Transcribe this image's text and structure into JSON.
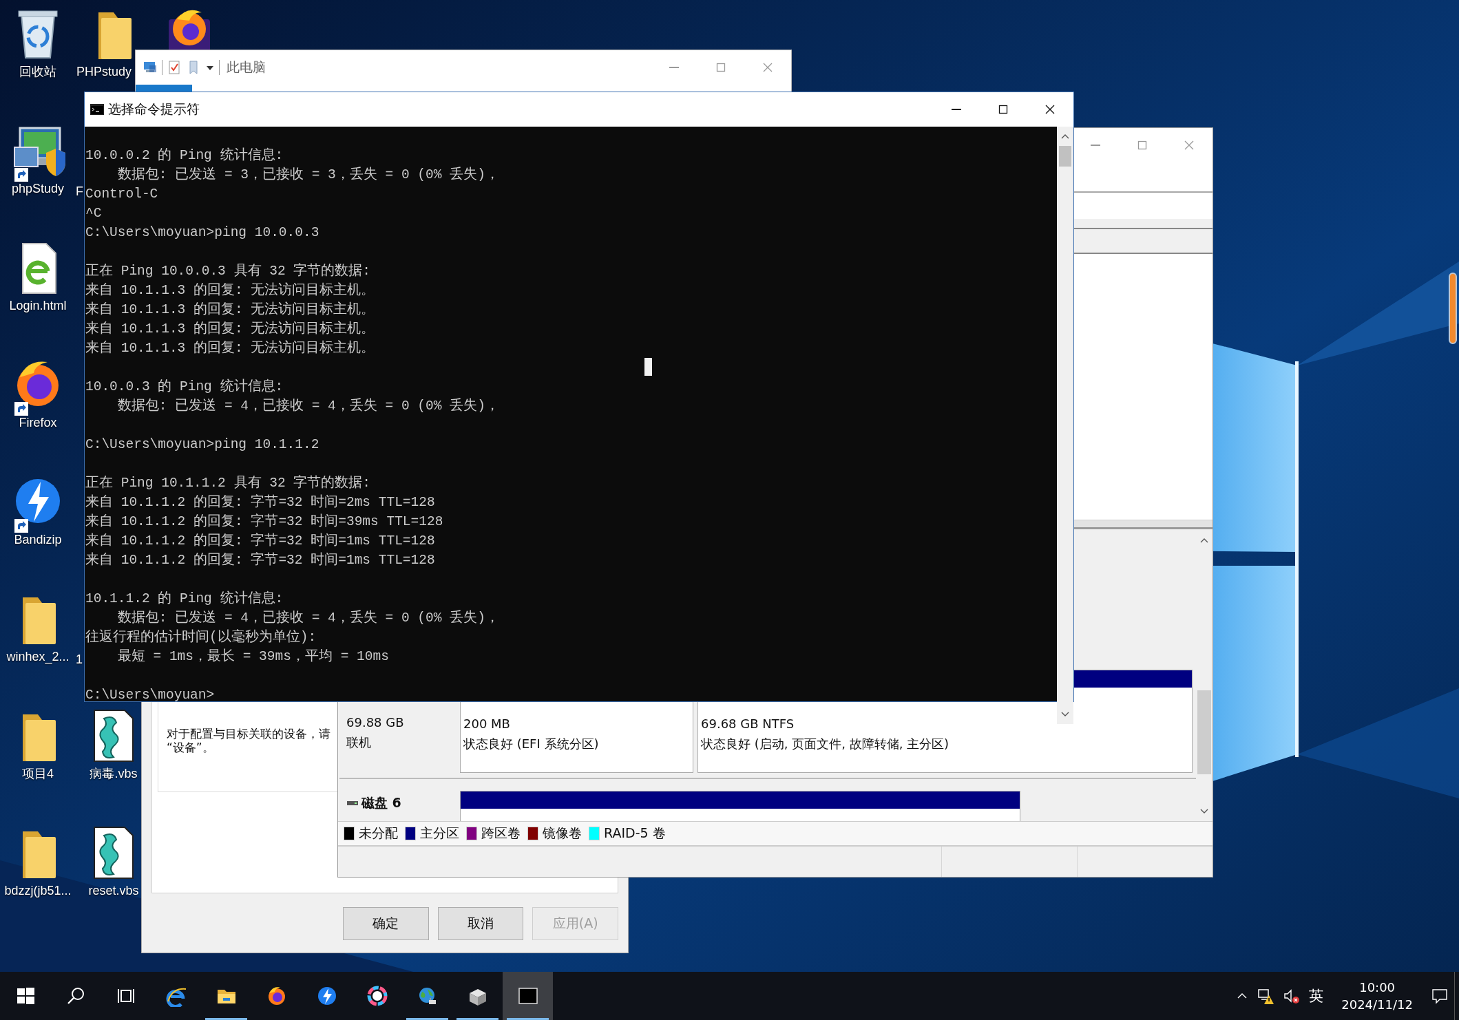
{
  "desktop": {
    "icons": [
      {
        "label": "回收站",
        "kind": "recycle-bin",
        "shortcut": false
      },
      {
        "label": "phpStudy",
        "kind": "phpstudy",
        "shortcut": true
      },
      {
        "label": "Login.html",
        "kind": "html-file",
        "shortcut": false
      },
      {
        "label": "Firefox",
        "kind": "firefox",
        "shortcut": true
      },
      {
        "label": "Bandizip",
        "kind": "bandizip",
        "shortcut": true
      },
      {
        "label": "winhex_2...",
        "kind": "folder",
        "shortcut": false
      },
      {
        "label": "项目4",
        "kind": "folder",
        "shortcut": false
      },
      {
        "label": "bdzzj(jb51...",
        "kind": "folder",
        "shortcut": false
      },
      {
        "label": "PHPstudy",
        "kind": "folder",
        "shortcut": false
      },
      {
        "label": "病毒.vbs",
        "kind": "script-file",
        "shortcut": false
      },
      {
        "label": "reset.vbs",
        "kind": "script-file",
        "shortcut": false
      },
      {
        "kind": "firefox-dev",
        "shortcut": false
      }
    ],
    "partial_labels": [
      "F",
      "1"
    ]
  },
  "explorer_window": {
    "title": "此电脑"
  },
  "disk_management": {
    "disks": [
      {
        "capacity": "69.88 GB",
        "status": "联机",
        "partitions": [
          {
            "size": "200 MB",
            "status": "状态良好 (EFI 系统分区)"
          },
          {
            "size": "69.68 GB NTFS",
            "status": "状态良好 (启动, 页面文件, 故障转储, 主分区)"
          }
        ]
      },
      {
        "name": "磁盘 6"
      }
    ],
    "legend": [
      {
        "label": "未分配",
        "color": "#000000"
      },
      {
        "label": "主分区",
        "color": "#000080"
      },
      {
        "label": "跨区卷",
        "color": "#800080"
      },
      {
        "label": "镜像卷",
        "color": "#800000"
      },
      {
        "label": "RAID-5 卷",
        "color": "#00ffff"
      }
    ]
  },
  "properties_dialog": {
    "text_lines": [
      "对于配置与目标关联的设备，请",
      "“设备”。"
    ],
    "buttons": [
      {
        "label": "确定",
        "disabled": false
      },
      {
        "label": "取消",
        "disabled": false
      },
      {
        "label": "应用(A)",
        "disabled": true
      }
    ]
  },
  "cmd_window": {
    "title": "选择命令提示符",
    "blocks": [
      [
        "10.0.0.2 的 Ping 统计信息:",
        "    数据包: 已发送 = 3，已接收 = 3，丢失 = 0 (0% 丢失)，",
        "Control-C",
        "^C",
        "C:\\Users\\moyuan>ping 10.0.0.3"
      ],
      [
        "正在 Ping 10.0.0.3 具有 32 字节的数据:",
        "来自 10.1.1.3 的回复: 无法访问目标主机。",
        "来自 10.1.1.3 的回复: 无法访问目标主机。",
        "来自 10.1.1.3 的回复: 无法访问目标主机。",
        "来自 10.1.1.3 的回复: 无法访问目标主机。"
      ],
      [
        "10.0.0.3 的 Ping 统计信息:",
        "    数据包: 已发送 = 4，已接收 = 4，丢失 = 0 (0% 丢失)，"
      ],
      [
        "C:\\Users\\moyuan>ping 10.1.1.2"
      ],
      [
        "正在 Ping 10.1.1.2 具有 32 字节的数据:",
        "来自 10.1.1.2 的回复: 字节=32 时间=2ms TTL=128",
        "来自 10.1.1.2 的回复: 字节=32 时间=39ms TTL=128",
        "来自 10.1.1.2 的回复: 字节=32 时间=1ms TTL=128",
        "来自 10.1.1.2 的回复: 字节=32 时间=1ms TTL=128"
      ],
      [
        "10.1.1.2 的 Ping 统计信息:",
        "    数据包: 已发送 = 4，已接收 = 4，丢失 = 0 (0% 丢失)，",
        "往返行程的估计时间(以毫秒为单位):",
        "    最短 = 1ms，最长 = 39ms，平均 = 10ms"
      ],
      [
        "C:\\Users\\moyuan>"
      ]
    ]
  },
  "taskbar": {
    "apps": [
      {
        "kind": "start",
        "running": false,
        "selected": false
      },
      {
        "kind": "search",
        "running": false,
        "selected": false
      },
      {
        "kind": "task-view",
        "running": false,
        "selected": false
      },
      {
        "kind": "ie",
        "running": false,
        "selected": false
      },
      {
        "kind": "explorer",
        "running": true,
        "selected": false
      },
      {
        "kind": "firefox",
        "running": false,
        "selected": false
      },
      {
        "kind": "bandizip",
        "running": false,
        "selected": false
      },
      {
        "kind": "ai-app",
        "running": false,
        "selected": false
      },
      {
        "kind": "globe",
        "running": true,
        "selected": false
      },
      {
        "kind": "package",
        "running": true,
        "selected": false
      },
      {
        "kind": "terminal",
        "running": true,
        "selected": true
      }
    ],
    "tray": {
      "input_method": "英",
      "time": "10:00",
      "date": "2024/11/12"
    }
  }
}
